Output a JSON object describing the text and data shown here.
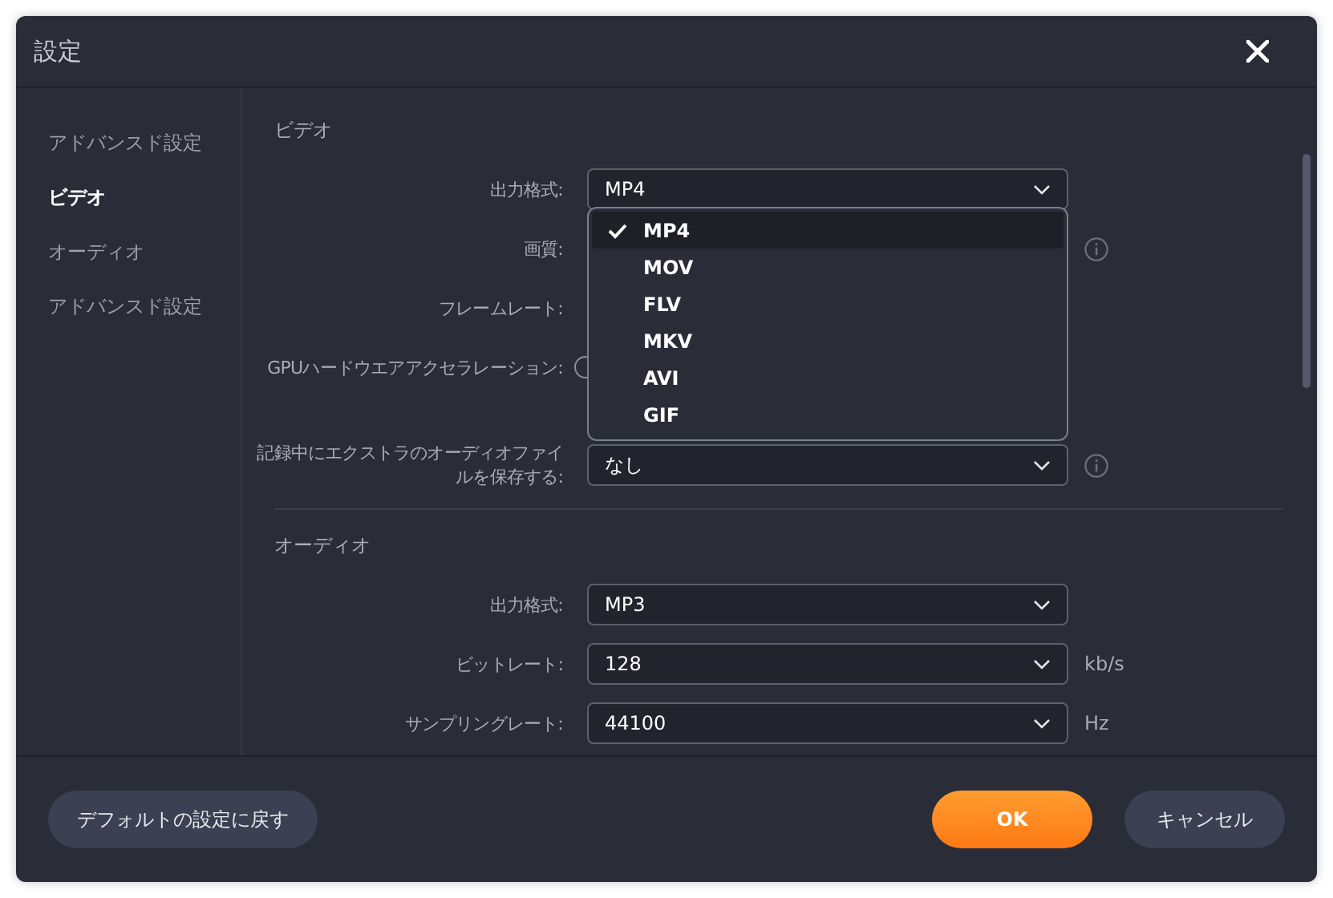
{
  "window": {
    "title": "設定"
  },
  "sidebar": {
    "items": [
      {
        "label": "アドバンスド設定",
        "selected": false
      },
      {
        "label": "ビデオ",
        "selected": true
      },
      {
        "label": "オーディオ",
        "selected": false
      },
      {
        "label": "アドバンスド設定",
        "selected": false
      }
    ]
  },
  "sections": [
    {
      "title": "ビデオ",
      "rows": [
        {
          "kind": "select",
          "label": "出力格式:",
          "value": "MP4",
          "info": false,
          "dropdown": {
            "options": [
              {
                "label": "MP4",
                "selected": true
              },
              {
                "label": "MOV",
                "selected": false
              },
              {
                "label": "FLV",
                "selected": false
              },
              {
                "label": "MKV",
                "selected": false
              },
              {
                "label": "AVI",
                "selected": false
              },
              {
                "label": "GIF",
                "selected": false
              }
            ]
          }
        },
        {
          "kind": "covered",
          "label": "画質:",
          "info": true
        },
        {
          "kind": "covered",
          "label": "フレームレート:",
          "info": false
        },
        {
          "kind": "toggle",
          "label": "GPUハードウエアアクセラレーション:",
          "info": false
        },
        {
          "kind": "select",
          "label": "記録中にエクストラのオーディオファイルを保存する:",
          "value": "なし",
          "info": true
        }
      ]
    },
    {
      "title": "オーディオ",
      "rows": [
        {
          "kind": "select",
          "label": "出力格式:",
          "value": "MP3",
          "info": false
        },
        {
          "kind": "select",
          "label": "ビットレート:",
          "value": "128",
          "info": false,
          "unit": "kb/s"
        },
        {
          "kind": "select",
          "label": "サンプリングレート:",
          "value": "44100",
          "info": false,
          "unit": "Hz"
        }
      ]
    }
  ],
  "footer": {
    "buttons": [
      {
        "label": "デフォルトの設定に戻す",
        "kind": "secondary"
      },
      {
        "label": "OK",
        "kind": "primary"
      },
      {
        "label": "キャンセル",
        "kind": "secondary"
      }
    ]
  }
}
